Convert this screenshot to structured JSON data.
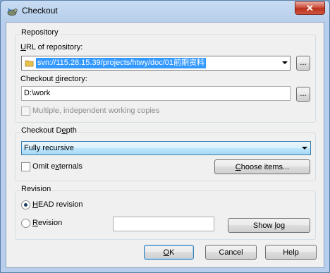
{
  "window": {
    "title": "Checkout",
    "close_glyph": "✕"
  },
  "repository": {
    "legend": "Repository",
    "url_label": "URL of repository:",
    "url_value": "svn://115.28.15.39/projects/htwy/doc/01前期资料",
    "browse_url_label": "...",
    "dir_label": "Checkout directory:",
    "dir_value": "D:\\work",
    "browse_dir_label": "...",
    "multi_wc_label": "Multiple, independent working copies"
  },
  "depth": {
    "legend": "Checkout Depth",
    "selected": "Fully recursive",
    "omit_externals_label": "Omit externals",
    "choose_items_label": "Choose items..."
  },
  "revision": {
    "legend": "Revision",
    "head_label": "HEAD revision",
    "revision_label": "Revision",
    "revision_value": "",
    "show_log_label": "Show log"
  },
  "buttons": {
    "ok": "OK",
    "cancel": "Cancel",
    "help": "Help"
  },
  "icons": {
    "app": "tortoisesvn-checkout-icon",
    "folder": "folder-icon",
    "close": "close-icon",
    "dropdown": "chevron-down-icon"
  },
  "colors": {
    "selection": "#3399ff",
    "dialog": "#f0f0f0",
    "titlebar": "#b7cfec",
    "close": "#c7452f"
  }
}
